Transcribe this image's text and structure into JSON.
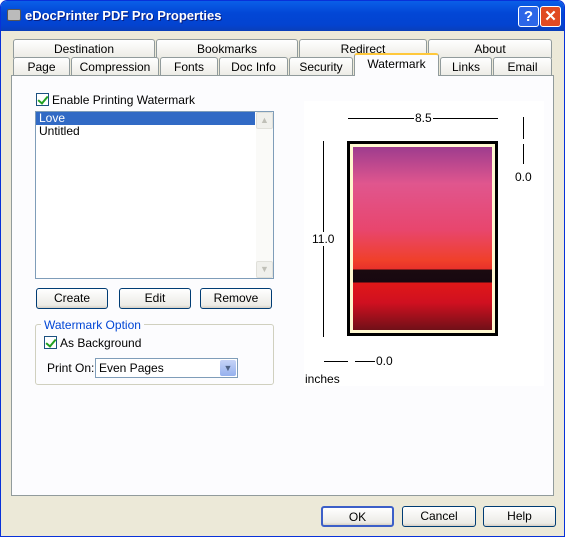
{
  "window": {
    "title": "eDocPrinter PDF Pro Properties",
    "help": "?",
    "close": "✕"
  },
  "tabs_row1": [
    "Destination",
    "Bookmarks",
    "Redirect",
    "About"
  ],
  "tabs_row2": [
    "Page",
    "Compression",
    "Fonts",
    "Doc Info",
    "Security",
    "Watermark",
    "Links",
    "Email"
  ],
  "selected_tab": "Watermark",
  "watermark": {
    "enable_label": "Enable Printing Watermark",
    "enable_checked": true,
    "list": [
      "Love",
      "Untitled"
    ],
    "selected": "Love",
    "buttons": {
      "create": "Create",
      "edit": "Edit",
      "remove": "Remove"
    },
    "option_group": "Watermark Option",
    "as_background_label": "As Background",
    "as_background_checked": true,
    "print_on_label": "Print On:",
    "print_on_value": "Even Pages"
  },
  "preview": {
    "width": "8.5",
    "height": "11.0",
    "top_offset": "0.0",
    "left_offset": "0.0",
    "units": "inches"
  },
  "footer": {
    "ok": "OK",
    "cancel": "Cancel",
    "help": "Help"
  }
}
